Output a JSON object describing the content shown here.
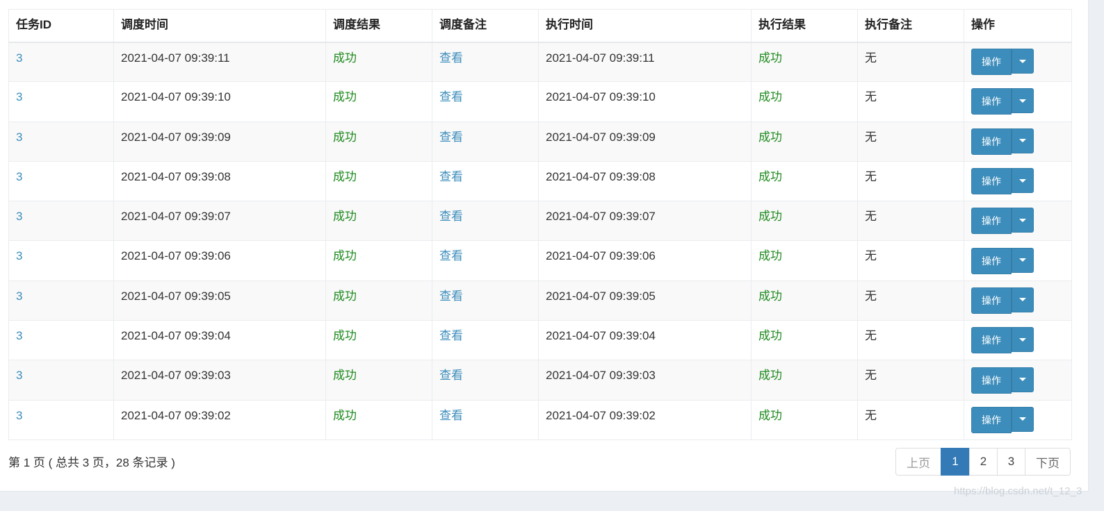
{
  "table": {
    "headers": [
      "任务ID",
      "调度时间",
      "调度结果",
      "调度备注",
      "执行时间",
      "执行结果",
      "执行备注",
      "操作"
    ],
    "rows": [
      {
        "task_id": "3",
        "trigger_time": "2021-04-07 09:39:11",
        "trigger_result": "成功",
        "trigger_note": "查看",
        "exec_time": "2021-04-07 09:39:11",
        "exec_result": "成功",
        "exec_note": "无",
        "action": "操作"
      },
      {
        "task_id": "3",
        "trigger_time": "2021-04-07 09:39:10",
        "trigger_result": "成功",
        "trigger_note": "查看",
        "exec_time": "2021-04-07 09:39:10",
        "exec_result": "成功",
        "exec_note": "无",
        "action": "操作"
      },
      {
        "task_id": "3",
        "trigger_time": "2021-04-07 09:39:09",
        "trigger_result": "成功",
        "trigger_note": "查看",
        "exec_time": "2021-04-07 09:39:09",
        "exec_result": "成功",
        "exec_note": "无",
        "action": "操作"
      },
      {
        "task_id": "3",
        "trigger_time": "2021-04-07 09:39:08",
        "trigger_result": "成功",
        "trigger_note": "查看",
        "exec_time": "2021-04-07 09:39:08",
        "exec_result": "成功",
        "exec_note": "无",
        "action": "操作"
      },
      {
        "task_id": "3",
        "trigger_time": "2021-04-07 09:39:07",
        "trigger_result": "成功",
        "trigger_note": "查看",
        "exec_time": "2021-04-07 09:39:07",
        "exec_result": "成功",
        "exec_note": "无",
        "action": "操作"
      },
      {
        "task_id": "3",
        "trigger_time": "2021-04-07 09:39:06",
        "trigger_result": "成功",
        "trigger_note": "查看",
        "exec_time": "2021-04-07 09:39:06",
        "exec_result": "成功",
        "exec_note": "无",
        "action": "操作"
      },
      {
        "task_id": "3",
        "trigger_time": "2021-04-07 09:39:05",
        "trigger_result": "成功",
        "trigger_note": "查看",
        "exec_time": "2021-04-07 09:39:05",
        "exec_result": "成功",
        "exec_note": "无",
        "action": "操作"
      },
      {
        "task_id": "3",
        "trigger_time": "2021-04-07 09:39:04",
        "trigger_result": "成功",
        "trigger_note": "查看",
        "exec_time": "2021-04-07 09:39:04",
        "exec_result": "成功",
        "exec_note": "无",
        "action": "操作"
      },
      {
        "task_id": "3",
        "trigger_time": "2021-04-07 09:39:03",
        "trigger_result": "成功",
        "trigger_note": "查看",
        "exec_time": "2021-04-07 09:39:03",
        "exec_result": "成功",
        "exec_note": "无",
        "action": "操作"
      },
      {
        "task_id": "3",
        "trigger_time": "2021-04-07 09:39:02",
        "trigger_result": "成功",
        "trigger_note": "查看",
        "exec_time": "2021-04-07 09:39:02",
        "exec_result": "成功",
        "exec_note": "无",
        "action": "操作"
      }
    ]
  },
  "footer": {
    "info": "第 1 页 ( 总共 3 页，28 条记录 )"
  },
  "pagination": {
    "prev": "上页",
    "pages": [
      "1",
      "2",
      "3"
    ],
    "active_page": "1",
    "next": "下页"
  },
  "watermark": "https://blog.csdn.net/t_12_3",
  "colors": {
    "link": "#3c8dbc",
    "success": "#1e8a1e",
    "button": "#3c8dbc",
    "active_page": "#337ab7"
  },
  "icons": {
    "dropdown": "caret-down-icon"
  }
}
